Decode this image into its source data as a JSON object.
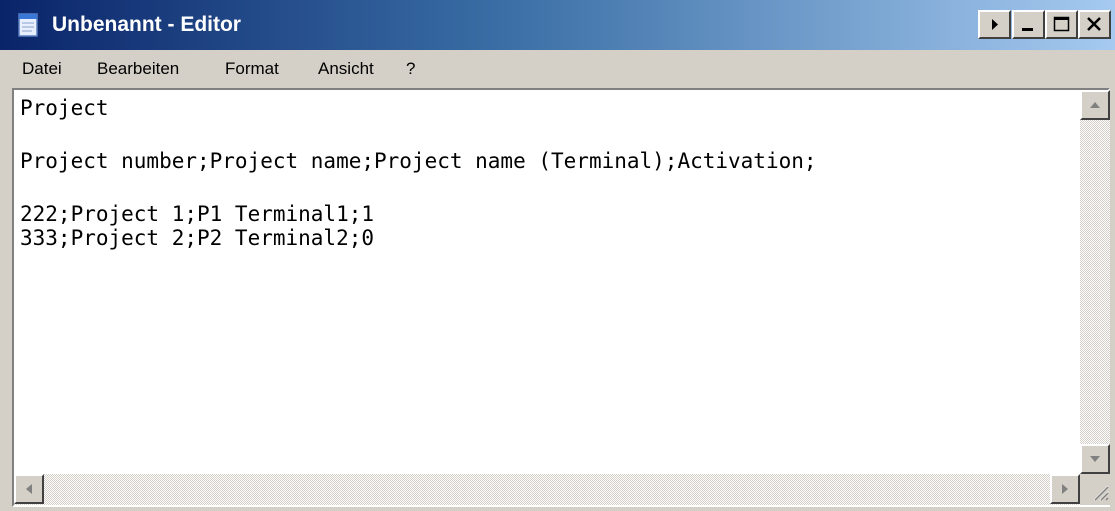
{
  "window": {
    "title": "Unbenannt - Editor",
    "icons": {
      "app": "notepad-icon",
      "help": "help-arrow-icon",
      "minimize": "minimize-icon",
      "maximize": "maximize-icon",
      "close": "close-icon"
    }
  },
  "menu": {
    "items": [
      "Datei",
      "Bearbeiten",
      "Format",
      "Ansicht",
      "?"
    ]
  },
  "editor": {
    "lines": [
      "Project",
      "",
      "Project number;Project name;Project name (Terminal);Activation;",
      "",
      "222;Project 1;P1 Terminal1;1",
      "333;Project 2;P2 Terminal2;0"
    ]
  },
  "colors": {
    "titlebar_start": "#0a246a",
    "titlebar_end": "#a6caf0",
    "chrome": "#d4d0c8"
  }
}
